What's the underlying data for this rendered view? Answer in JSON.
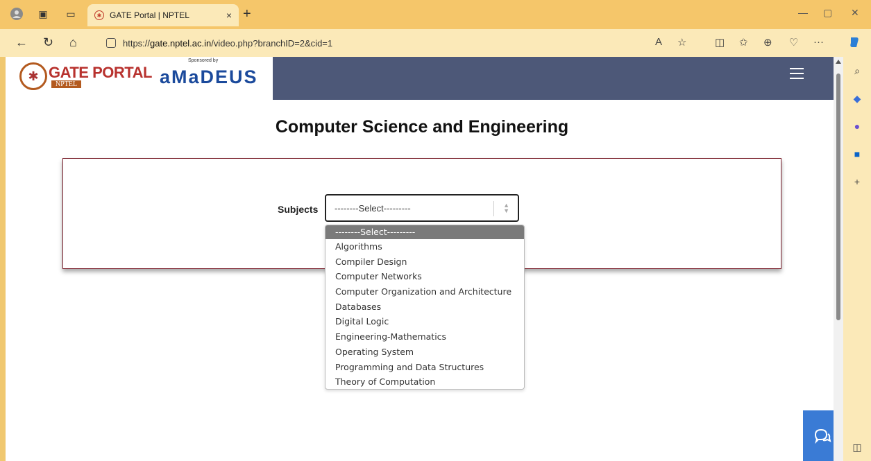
{
  "browser": {
    "tab_title": "GATE Portal | NPTEL",
    "tab_close": "×",
    "new_tab": "+",
    "url_prefix": "https://",
    "url_host": "gate.nptel.ac.in",
    "url_path": "/video.php?branchID=2&cid=1",
    "read_aloud": "A",
    "more": "···"
  },
  "site": {
    "logo_title": "GATE PORTAL",
    "logo_sub": "NPTEL",
    "sponsor_label": "Sponsored by",
    "sponsor_name": "aMaDEUS"
  },
  "page": {
    "title": "Computer Science and Engineering",
    "subjects_label": "Subjects",
    "select_value": "--------Select---------"
  },
  "dropdown": {
    "options": [
      "--------Select---------",
      "Algorithms",
      "Compiler Design",
      "Computer Networks",
      "Computer Organization and Architecture",
      "Databases",
      "Digital Logic",
      "Engineering-Mathematics",
      "Operating System",
      "Programming and Data Structures",
      "Theory of Computation"
    ],
    "selected_index": 0
  },
  "colors": {
    "chrome": "#f5c66a",
    "navbar": "#4d5878",
    "card_border": "#7a1f2b",
    "chat": "#3a7bd5"
  }
}
